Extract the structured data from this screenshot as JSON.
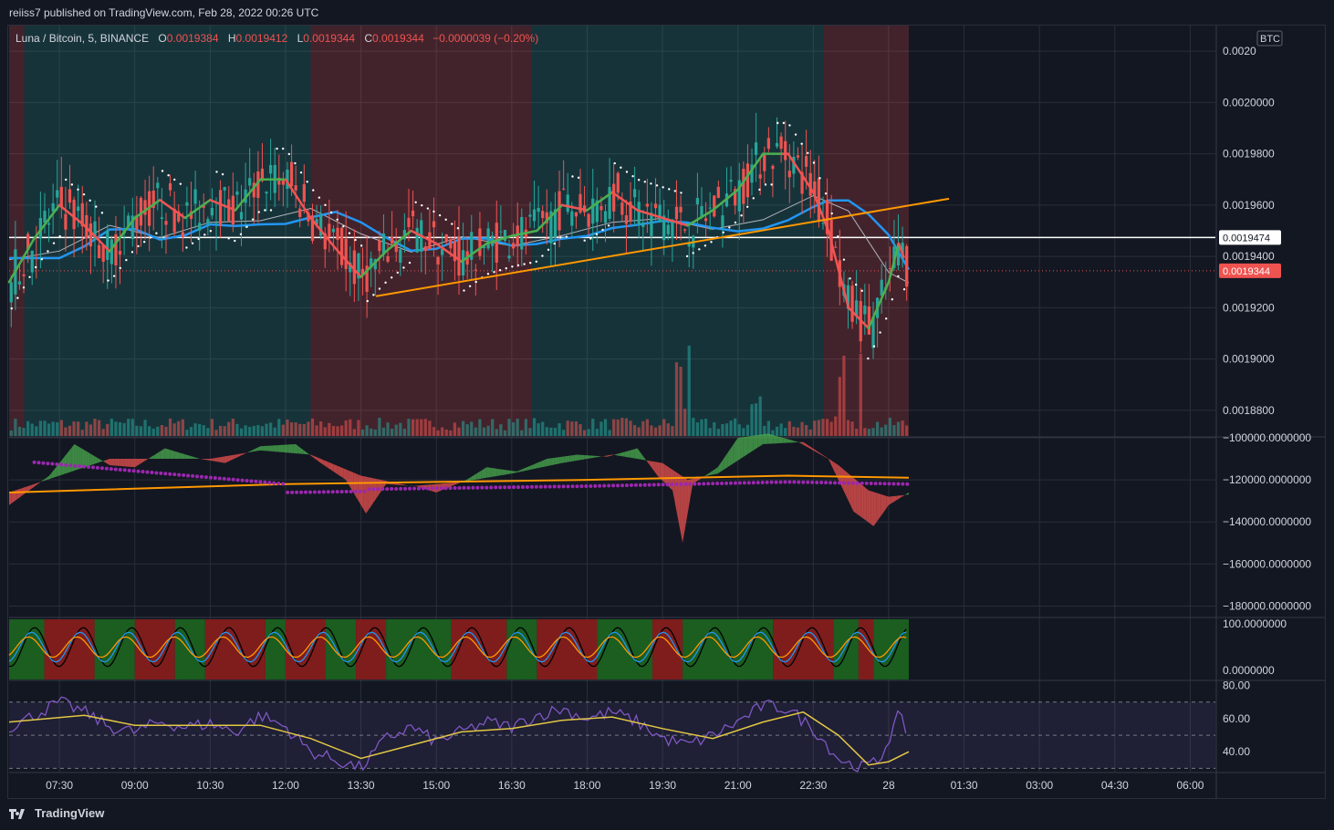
{
  "header": {
    "published": "reiiss7 published on TradingView.com, Feb 28, 2022 00:26 UTC"
  },
  "legend": {
    "symbol": "Luna / Bitcoin, 5, BINANCE",
    "open_label": "O",
    "open": "0.0019384",
    "high_label": "H",
    "high": "0.0019412",
    "low_label": "L",
    "low": "0.0019344",
    "close_label": "C",
    "close": "0.0019344",
    "change": "−0.0000039 (−0.20%)"
  },
  "colors": {
    "up": "#26a69a",
    "down": "#ef5350",
    "background": "#131722",
    "grid": "#2a2e39",
    "ema_blue": "#2196f3",
    "trendline": "#ff9800",
    "psar_purple": "#9c27b0"
  },
  "chart_data": [
    {
      "type": "candlestick",
      "name": "price",
      "currency": "BTC",
      "ylim": [
        0.00187,
        0.00203
      ],
      "y_ticks": [
        "0.0020",
        "0.0020000",
        "0.0019800",
        "0.0019600",
        "0.0019400",
        "0.0019200",
        "0.0019000",
        "0.0018800"
      ],
      "y_tick_values": [
        0.00202,
        0.002,
        0.00198,
        0.00196,
        0.00194,
        0.00192,
        0.0019,
        0.00188
      ],
      "x_ticks": [
        "07:30",
        "09:00",
        "10:30",
        "12:00",
        "13:30",
        "15:00",
        "16:30",
        "18:00",
        "19:30",
        "21:00",
        "22:30",
        "28",
        "01:30",
        "03:00",
        "04:30",
        "06:00"
      ],
      "x_tick_hours": [
        7.5,
        9,
        10.5,
        12,
        13.5,
        15,
        16.5,
        18,
        19.5,
        21,
        22.5,
        24,
        25.5,
        27,
        28.5,
        30
      ],
      "x_start_hour": 6.5,
      "last_bar_hour": 24.4,
      "horizontal_level": {
        "value": 0.0019474,
        "label": "0.0019474"
      },
      "last_price": {
        "value": 0.0019344,
        "label": "0.0019344"
      },
      "trendline": {
        "from": [
          13.8,
          0.0019245
        ],
        "to": [
          25.2,
          0.0019625
        ]
      },
      "regimes": [
        {
          "from": 6.5,
          "to": 6.8,
          "state": "bearish"
        },
        {
          "from": 6.8,
          "to": 12.5,
          "state": "bullish"
        },
        {
          "from": 12.5,
          "to": 16.9,
          "state": "bearish"
        },
        {
          "from": 16.9,
          "to": 22.7,
          "state": "bullish"
        },
        {
          "from": 22.7,
          "to": 24.4,
          "state": "bearish"
        }
      ],
      "close_path": [
        [
          6.5,
          0.00193
        ],
        [
          7.0,
          0.001947
        ],
        [
          7.5,
          0.00196
        ],
        [
          8.0,
          0.001952
        ],
        [
          8.5,
          0.001942
        ],
        [
          9.0,
          0.001955
        ],
        [
          9.5,
          0.001962
        ],
        [
          10.0,
          0.001955
        ],
        [
          10.5,
          0.001962
        ],
        [
          11.0,
          0.001958
        ],
        [
          11.5,
          0.00197
        ],
        [
          12.0,
          0.00197
        ],
        [
          12.5,
          0.001955
        ],
        [
          13.0,
          0.001943
        ],
        [
          13.5,
          0.001932
        ],
        [
          14.0,
          0.001942
        ],
        [
          14.5,
          0.00195
        ],
        [
          15.0,
          0.001945
        ],
        [
          15.5,
          0.001938
        ],
        [
          16.0,
          0.001945
        ],
        [
          16.5,
          0.001948
        ],
        [
          17.0,
          0.00195
        ],
        [
          17.5,
          0.00196
        ],
        [
          18.0,
          0.001958
        ],
        [
          18.5,
          0.001965
        ],
        [
          19.0,
          0.001958
        ],
        [
          19.5,
          0.001955
        ],
        [
          20.0,
          0.001952
        ],
        [
          20.5,
          0.001958
        ],
        [
          21.0,
          0.001966
        ],
        [
          21.5,
          0.00198
        ],
        [
          22.0,
          0.00198
        ],
        [
          22.5,
          0.001965
        ],
        [
          22.8,
          0.00195
        ],
        [
          23.2,
          0.00192
        ],
        [
          23.6,
          0.001912
        ],
        [
          24.0,
          0.00193
        ],
        [
          24.2,
          0.001945
        ],
        [
          24.4,
          0.0019344
        ]
      ]
    },
    {
      "type": "area",
      "name": "oscillator",
      "ylim": [
        -185000,
        -100000
      ],
      "y_ticks": [
        "−100000.0000000",
        "−120000.0000000",
        "−140000.0000000",
        "−160000.0000000",
        "−180000.0000000"
      ],
      "y_tick_values": [
        -100000,
        -120000,
        -140000,
        -160000,
        -180000
      ],
      "fast": [
        [
          6.5,
          -132000
        ],
        [
          7.3,
          -118000
        ],
        [
          7.8,
          -103000
        ],
        [
          8.5,
          -113000
        ],
        [
          9.0,
          -114000
        ],
        [
          9.6,
          -105000
        ],
        [
          10.3,
          -110000
        ],
        [
          10.8,
          -112000
        ],
        [
          11.5,
          -104000
        ],
        [
          12.2,
          -103000
        ],
        [
          12.7,
          -112000
        ],
        [
          13.2,
          -120000
        ],
        [
          13.6,
          -136000
        ],
        [
          14.0,
          -122000
        ],
        [
          14.6,
          -123000
        ],
        [
          15.0,
          -126000
        ],
        [
          15.6,
          -120000
        ],
        [
          16.0,
          -114000
        ],
        [
          16.6,
          -116000
        ],
        [
          17.2,
          -110000
        ],
        [
          17.8,
          -108000
        ],
        [
          18.4,
          -109000
        ],
        [
          19.0,
          -105000
        ],
        [
          19.4,
          -118000
        ],
        [
          19.7,
          -125000
        ],
        [
          19.9,
          -150000
        ],
        [
          20.1,
          -122000
        ],
        [
          20.6,
          -114000
        ],
        [
          21.0,
          -100000
        ],
        [
          21.6,
          -98000
        ],
        [
          22.2,
          -102000
        ],
        [
          22.8,
          -110000
        ],
        [
          23.3,
          -135000
        ],
        [
          23.7,
          -142000
        ],
        [
          24.0,
          -132000
        ],
        [
          24.4,
          -126000
        ]
      ],
      "slow": [
        [
          6.5,
          -126000
        ],
        [
          7.5,
          -118000
        ],
        [
          8.5,
          -110000
        ],
        [
          9.5,
          -110000
        ],
        [
          10.5,
          -110000
        ],
        [
          11.5,
          -106000
        ],
        [
          12.5,
          -108000
        ],
        [
          13.5,
          -118000
        ],
        [
          14.5,
          -123000
        ],
        [
          15.5,
          -121000
        ],
        [
          16.5,
          -117000
        ],
        [
          17.5,
          -112000
        ],
        [
          18.5,
          -108000
        ],
        [
          19.5,
          -112000
        ],
        [
          20.0,
          -120000
        ],
        [
          20.6,
          -117000
        ],
        [
          21.5,
          -103000
        ],
        [
          22.3,
          -102000
        ],
        [
          23.0,
          -113000
        ],
        [
          23.6,
          -125000
        ],
        [
          24.0,
          -128000
        ],
        [
          24.4,
          -127000
        ]
      ],
      "signal": [
        [
          6.5,
          -126000
        ],
        [
          12.0,
          -122000
        ],
        [
          15.0,
          -121000
        ],
        [
          18.0,
          -120000
        ],
        [
          20.0,
          -119000
        ],
        [
          22.0,
          -118000
        ],
        [
          24.4,
          -119000
        ]
      ]
    },
    {
      "type": "line",
      "name": "momentum",
      "ylim": [
        -20,
        110
      ],
      "y_ticks": [
        "100.0000000",
        "0.0000000"
      ],
      "y_tick_values": [
        100,
        0
      ],
      "zones": [
        {
          "from": 6.5,
          "to": 7.2,
          "state": "bullish"
        },
        {
          "from": 7.2,
          "to": 8.2,
          "state": "bearish"
        },
        {
          "from": 8.2,
          "to": 9.0,
          "state": "bullish"
        },
        {
          "from": 9.0,
          "to": 9.8,
          "state": "bearish"
        },
        {
          "from": 9.8,
          "to": 10.4,
          "state": "bullish"
        },
        {
          "from": 10.4,
          "to": 11.6,
          "state": "bearish"
        },
        {
          "from": 11.6,
          "to": 12.0,
          "state": "bullish"
        },
        {
          "from": 12.0,
          "to": 12.8,
          "state": "bearish"
        },
        {
          "from": 12.8,
          "to": 13.4,
          "state": "bullish"
        },
        {
          "from": 13.4,
          "to": 14.0,
          "state": "bearish"
        },
        {
          "from": 14.0,
          "to": 15.3,
          "state": "bullish"
        },
        {
          "from": 15.3,
          "to": 16.4,
          "state": "bearish"
        },
        {
          "from": 16.4,
          "to": 17.0,
          "state": "bullish"
        },
        {
          "from": 17.0,
          "to": 18.2,
          "state": "bearish"
        },
        {
          "from": 18.2,
          "to": 19.3,
          "state": "bullish"
        },
        {
          "from": 19.3,
          "to": 19.9,
          "state": "bearish"
        },
        {
          "from": 19.9,
          "to": 21.7,
          "state": "bullish"
        },
        {
          "from": 21.7,
          "to": 22.9,
          "state": "bearish"
        },
        {
          "from": 22.9,
          "to": 23.4,
          "state": "bullish"
        },
        {
          "from": 23.4,
          "to": 23.7,
          "state": "bearish"
        },
        {
          "from": 23.7,
          "to": 24.4,
          "state": "bullish"
        }
      ]
    },
    {
      "type": "line",
      "name": "rsi",
      "ylim": [
        28,
        82
      ],
      "y_ticks": [
        "80.00",
        "60.00",
        "40.00"
      ],
      "y_tick_values": [
        80,
        60,
        40
      ],
      "band": [
        30,
        70
      ],
      "midline": 50,
      "rsi": [
        [
          6.5,
          55
        ],
        [
          7.0,
          62
        ],
        [
          7.5,
          70
        ],
        [
          8.0,
          64
        ],
        [
          8.5,
          55
        ],
        [
          9.0,
          52
        ],
        [
          9.5,
          58
        ],
        [
          10.0,
          55
        ],
        [
          10.5,
          57
        ],
        [
          11.0,
          52
        ],
        [
          11.5,
          62
        ],
        [
          12.0,
          55
        ],
        [
          12.5,
          40
        ],
        [
          13.0,
          35
        ],
        [
          13.5,
          30
        ],
        [
          14.0,
          48
        ],
        [
          14.5,
          55
        ],
        [
          15.0,
          46
        ],
        [
          15.5,
          52
        ],
        [
          16.0,
          58
        ],
        [
          16.5,
          55
        ],
        [
          17.0,
          62
        ],
        [
          17.5,
          66
        ],
        [
          18.0,
          60
        ],
        [
          18.5,
          64
        ],
        [
          19.0,
          58
        ],
        [
          19.5,
          48
        ],
        [
          20.0,
          44
        ],
        [
          20.5,
          50
        ],
        [
          21.0,
          58
        ],
        [
          21.5,
          68
        ],
        [
          22.0,
          66
        ],
        [
          22.5,
          54
        ],
        [
          23.0,
          36
        ],
        [
          23.4,
          30
        ],
        [
          23.8,
          34
        ],
        [
          24.2,
          62
        ],
        [
          24.4,
          50
        ]
      ],
      "smooth": [
        [
          6.5,
          58
        ],
        [
          8.0,
          62
        ],
        [
          9.0,
          56
        ],
        [
          10.5,
          56
        ],
        [
          11.5,
          56
        ],
        [
          12.5,
          48
        ],
        [
          13.5,
          36
        ],
        [
          14.5,
          44
        ],
        [
          15.5,
          52
        ],
        [
          16.5,
          54
        ],
        [
          17.5,
          59
        ],
        [
          18.5,
          61
        ],
        [
          19.5,
          54
        ],
        [
          20.5,
          48
        ],
        [
          21.5,
          58
        ],
        [
          22.3,
          64
        ],
        [
          23.0,
          50
        ],
        [
          23.6,
          32
        ],
        [
          24.0,
          34
        ],
        [
          24.4,
          40
        ]
      ]
    }
  ],
  "footer": {
    "brand": "TradingView"
  }
}
